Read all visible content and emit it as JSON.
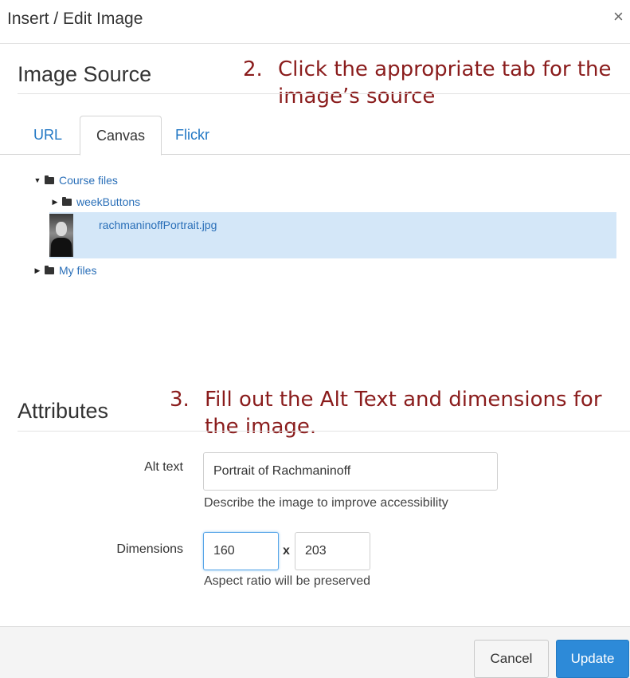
{
  "dialog": {
    "title": "Insert / Edit Image",
    "close_glyph": "×"
  },
  "image_source": {
    "heading": "Image Source",
    "annotation": {
      "number": "2.",
      "line1": "Click the appropriate tab for the",
      "line2": "image’s source"
    },
    "tabs": [
      {
        "label": "URL",
        "active": false
      },
      {
        "label": "Canvas",
        "active": true
      },
      {
        "label": "Flickr",
        "active": false
      }
    ],
    "tree": {
      "course_files": "Course files",
      "week_buttons": "weekButtons",
      "selected_file": "rachmaninoffPortrait.jpg",
      "my_files": "My files"
    },
    "icons": {
      "expanded": "caret-down-icon",
      "collapsed": "caret-right-icon",
      "folder": "folder-icon"
    },
    "selected_row_color": "#d4e7f8"
  },
  "attributes": {
    "heading": "Attributes",
    "annotation": {
      "number": "3.",
      "line1": "Fill out the Alt Text and dimensions for",
      "line2": "the image."
    },
    "alt_text": {
      "label": "Alt text",
      "value": "Portrait of Rachmaninoff",
      "help": "Describe the image to improve accessibility"
    },
    "dimensions": {
      "label": "Dimensions",
      "width": "160",
      "separator": "x",
      "height": "203",
      "help": "Aspect ratio will be preserved"
    }
  },
  "footer": {
    "cancel_label": "Cancel",
    "update_label": "Update"
  },
  "colors": {
    "link": "#2a6fb8",
    "annotation": "#8a1c1c",
    "primary_button": "#2d8ad8"
  }
}
